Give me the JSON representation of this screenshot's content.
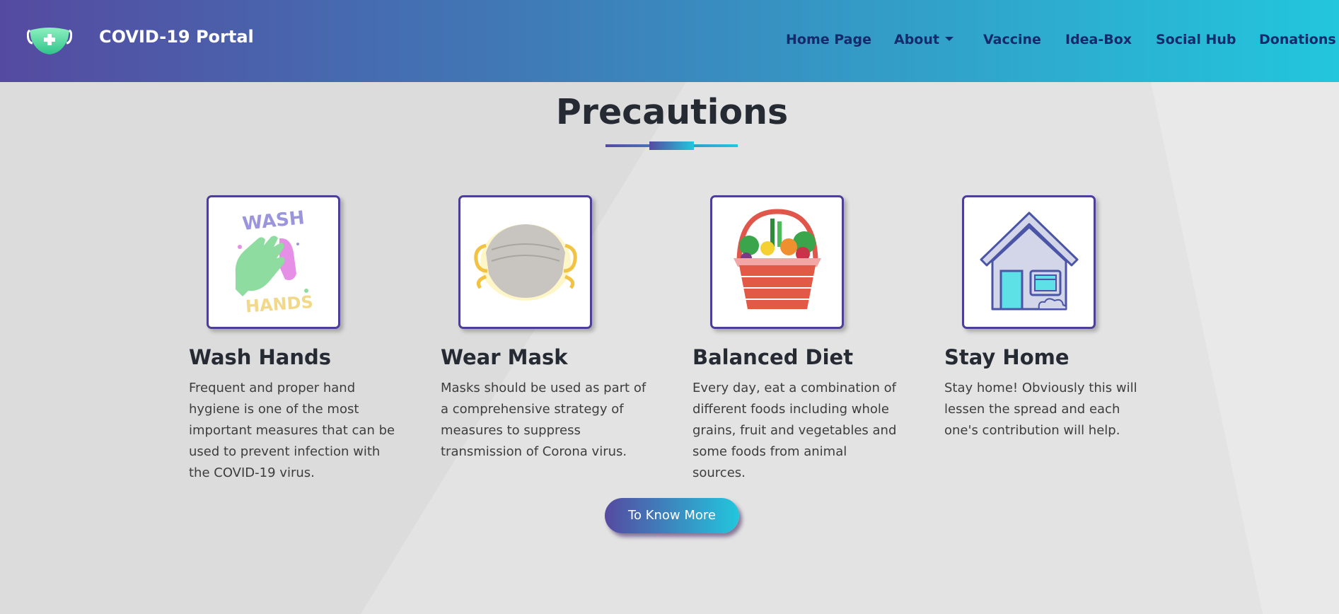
{
  "navbar": {
    "brand_text": "COVID-19 Portal",
    "logo_icon": "mask-plus-icon",
    "items": [
      {
        "label": "Home Page"
      },
      {
        "label": "About"
      },
      {
        "label": "Vaccine"
      },
      {
        "label": "Idea-Box"
      },
      {
        "label": "Social Hub"
      },
      {
        "label": "Donations"
      }
    ]
  },
  "section": {
    "title": "Precautions"
  },
  "cards": [
    {
      "title": "Wash Hands",
      "text": "Frequent and proper hand hygiene is one of the most important measures that can be used to prevent infection with the COVID-19 virus.",
      "icon": "wash-hands-icon",
      "icon_text_top": "WASH",
      "icon_text_bottom": "HANDS"
    },
    {
      "title": "Wear Mask",
      "text": "Masks should be used as part of a comprehensive strategy of measures to suppress transmission of Corona virus.",
      "icon": "face-mask-icon"
    },
    {
      "title": "Balanced Diet",
      "text": "Every day, eat a combination of different foods including whole grains, fruit and vegetables and some foods from animal sources.",
      "icon": "food-basket-icon"
    },
    {
      "title": "Stay Home",
      "text": "Stay home! Obviously this will lessen the spread and each one's contribution will help.",
      "icon": "house-icon"
    }
  ],
  "cta": {
    "label": "To Know More"
  },
  "colors": {
    "brand_start": "#554aa1",
    "brand_end": "#22c6dd",
    "nav_link": "#142a6b",
    "card_border": "#4b3f98"
  }
}
